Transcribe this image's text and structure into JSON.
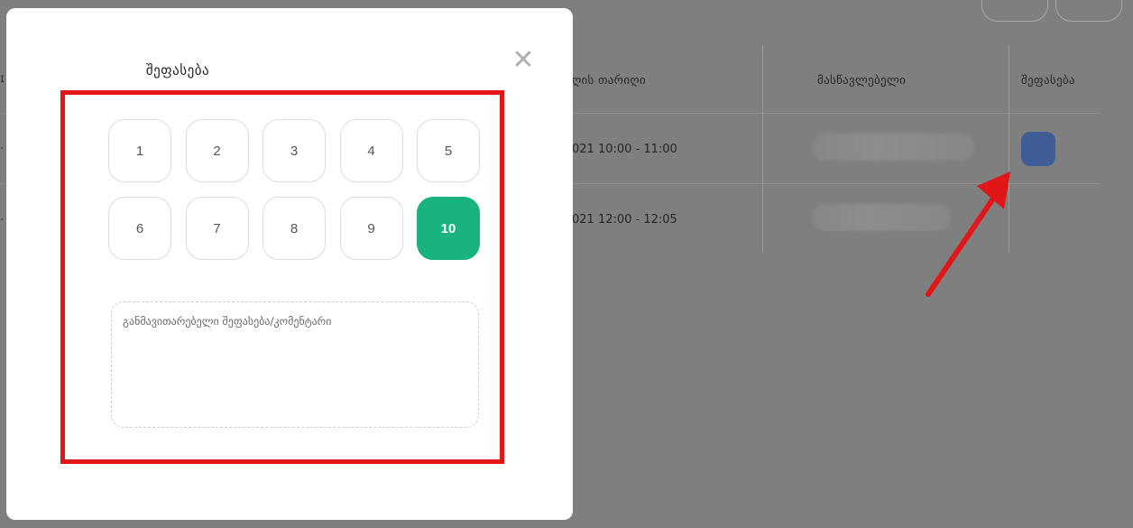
{
  "modal": {
    "title": "შეფასება",
    "close_symbol": "✕",
    "rating_options": [
      "1",
      "2",
      "3",
      "4",
      "5",
      "6",
      "7",
      "8",
      "9",
      "10"
    ],
    "selected_rating": "10",
    "comment_placeholder": "განმავითარებელი შეფასება/კომენტარი"
  },
  "background_table": {
    "headers": {
      "date": "ღის თარიღი",
      "lecturer": "მასწავლებელი",
      "rating": "შეფასება"
    },
    "rows": [
      {
        "datetime": "021 10:00 - 11:00"
      },
      {
        "datetime": "021 12:00 - 12:05"
      }
    ]
  },
  "colors": {
    "selected_rating": "#18b37e",
    "highlight_box": "#e11717",
    "rate_button": "#3f5d99",
    "overlay": "#7f7f7f"
  },
  "icons": {
    "close": "close-icon",
    "arrow": "red-arrow-annotation"
  }
}
